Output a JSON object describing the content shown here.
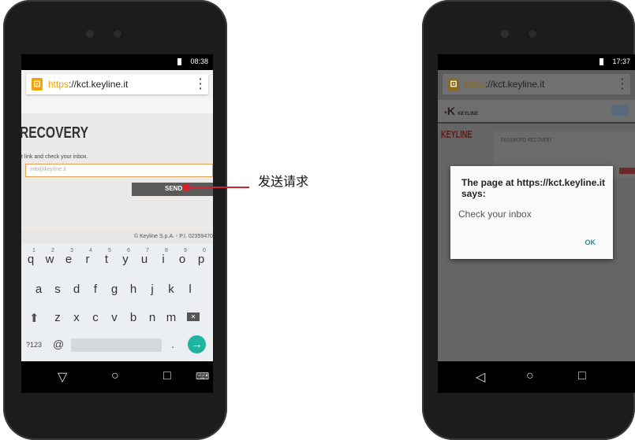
{
  "left_phone": {
    "status_time": "08:38",
    "url_https": "https",
    "url_rest": "://kct.keyline.it",
    "recovery_title": "RECOVERY",
    "instruction": "t link and check your inbox.",
    "email_placeholder": "info@keyline.it",
    "send_label": "SEND",
    "footer_text": "© Keyline S.p.A. - P.I. 02359470",
    "keyboard": {
      "row1": [
        "q",
        "w",
        "e",
        "r",
        "t",
        "y",
        "u",
        "i",
        "o",
        "p"
      ],
      "row1_nums": [
        "1",
        "2",
        "3",
        "4",
        "5",
        "6",
        "7",
        "8",
        "9",
        "0"
      ],
      "row2": [
        "a",
        "s",
        "d",
        "f",
        "g",
        "h",
        "j",
        "k",
        "l"
      ],
      "row3": [
        "z",
        "x",
        "c",
        "v",
        "b",
        "n",
        "m"
      ],
      "mode_key": "?123",
      "at_key": "@",
      "dot_key": "."
    }
  },
  "annotation": {
    "label": "发送请求",
    "color": "#d0262b"
  },
  "right_phone": {
    "status_time": "17:37",
    "url_https": "https",
    "url_rest": "://kct.keyline.it",
    "brand": "KEYLINE",
    "side_logo": "KEYLINE",
    "panel_title": "PASSWORD RECOVERY",
    "dialog_title": "The page at https://kct.keyline.it says:",
    "dialog_message": "Check your inbox",
    "dialog_ok": "OK"
  },
  "colors": {
    "accent_orange": "#f0a30a",
    "send_button": "#5a5a5a",
    "dialog_ok": "#2a8a8a",
    "keyline_red": "#c0272d"
  }
}
